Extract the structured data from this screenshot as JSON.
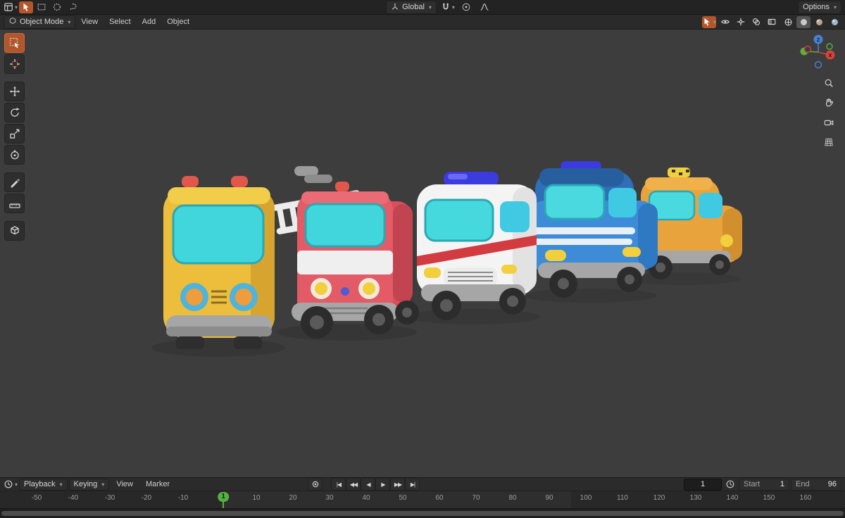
{
  "topbar": {
    "left_icons": [
      "editor-type-selector",
      "select-tweak",
      "select-box",
      "select-circle",
      "select-lasso"
    ],
    "orientation_label": "Global",
    "snap_icons": [
      "snap-magnet",
      "snap-target"
    ],
    "proportional_icons": [
      "proportional-editing",
      "proportional-falloff"
    ],
    "options_label": "Options"
  },
  "header": {
    "mode_label": "Object Mode",
    "menus": [
      {
        "label": "View"
      },
      {
        "label": "Select"
      },
      {
        "label": "Add"
      },
      {
        "label": "Object"
      }
    ],
    "right_icons": [
      "visibility",
      "gizmos",
      "overlays",
      "xray"
    ],
    "shading_modes": [
      "shading-wireframe",
      "shading-solid",
      "shading-material",
      "shading-rendered"
    ],
    "active_shading": "shading-solid"
  },
  "toolbar": {
    "tools": [
      {
        "name": "select-box-tool",
        "active": true
      },
      {
        "name": "cursor-tool",
        "active": false
      },
      {
        "name": "move-tool",
        "active": false,
        "gap_before": true
      },
      {
        "name": "rotate-tool",
        "active": false
      },
      {
        "name": "scale-tool",
        "active": false
      },
      {
        "name": "transform-tool",
        "active": false
      },
      {
        "name": "annotate-tool",
        "active": false,
        "gap_before": true
      },
      {
        "name": "measure-tool",
        "active": false
      },
      {
        "name": "add-cube-tool",
        "active": false,
        "gap_before": true
      }
    ]
  },
  "viewport": {
    "objects": [
      {
        "name": "school-bus",
        "color": "#ecbe3b"
      },
      {
        "name": "fire-truck",
        "color": "#e35b66"
      },
      {
        "name": "ambulance",
        "color": "#f4f4f4"
      },
      {
        "name": "police-truck",
        "color": "#3e8cd8"
      },
      {
        "name": "taxi",
        "color": "#e8a33c"
      }
    ],
    "glass_color": "#45d8dc"
  },
  "gizmo": {
    "x_label": "X",
    "y_label": "Y",
    "z_label": "Z"
  },
  "nav_tools": [
    "zoom",
    "pan",
    "camera-view",
    "toggle-projection"
  ],
  "timeline": {
    "menus": [
      {
        "label": "Playback"
      },
      {
        "label": "Keying"
      },
      {
        "label": "View"
      },
      {
        "label": "Marker"
      }
    ],
    "auto_key": "record",
    "playback": [
      "jump-start",
      "prev-keyframe",
      "play-reverse",
      "play",
      "next-keyframe",
      "jump-end"
    ],
    "frame_field": "1",
    "start_label": "Start",
    "start_value": "1",
    "end_label": "End",
    "end_value": "96",
    "current_frame": 1,
    "frame_range": {
      "start": 1,
      "end": 96
    },
    "ruler_ticks": [
      {
        "label": "-50",
        "frame": -50
      },
      {
        "label": "-40",
        "frame": -40
      },
      {
        "label": "-30",
        "frame": -30
      },
      {
        "label": "-20",
        "frame": -20
      },
      {
        "label": "-10",
        "frame": -10
      },
      {
        "label": "10",
        "frame": 10
      },
      {
        "label": "20",
        "frame": 20
      },
      {
        "label": "30",
        "frame": 30
      },
      {
        "label": "40",
        "frame": 40
      },
      {
        "label": "50",
        "frame": 50
      },
      {
        "label": "60",
        "frame": 60
      },
      {
        "label": "70",
        "frame": 70
      },
      {
        "label": "80",
        "frame": 80
      },
      {
        "label": "90",
        "frame": 90
      },
      {
        "label": "100",
        "frame": 100
      },
      {
        "label": "110",
        "frame": 110
      },
      {
        "label": "120",
        "frame": 120
      },
      {
        "label": "130",
        "frame": 130
      },
      {
        "label": "140",
        "frame": 140
      },
      {
        "label": "150",
        "frame": 150
      },
      {
        "label": "160",
        "frame": 160
      }
    ]
  },
  "colors": {
    "viewport_bg": "#3d3d3d",
    "topbar_bg": "#232323",
    "header_bg": "#2a2a2a",
    "active_tool": "#b4562b",
    "frame_marker_green": "#54b33e"
  }
}
